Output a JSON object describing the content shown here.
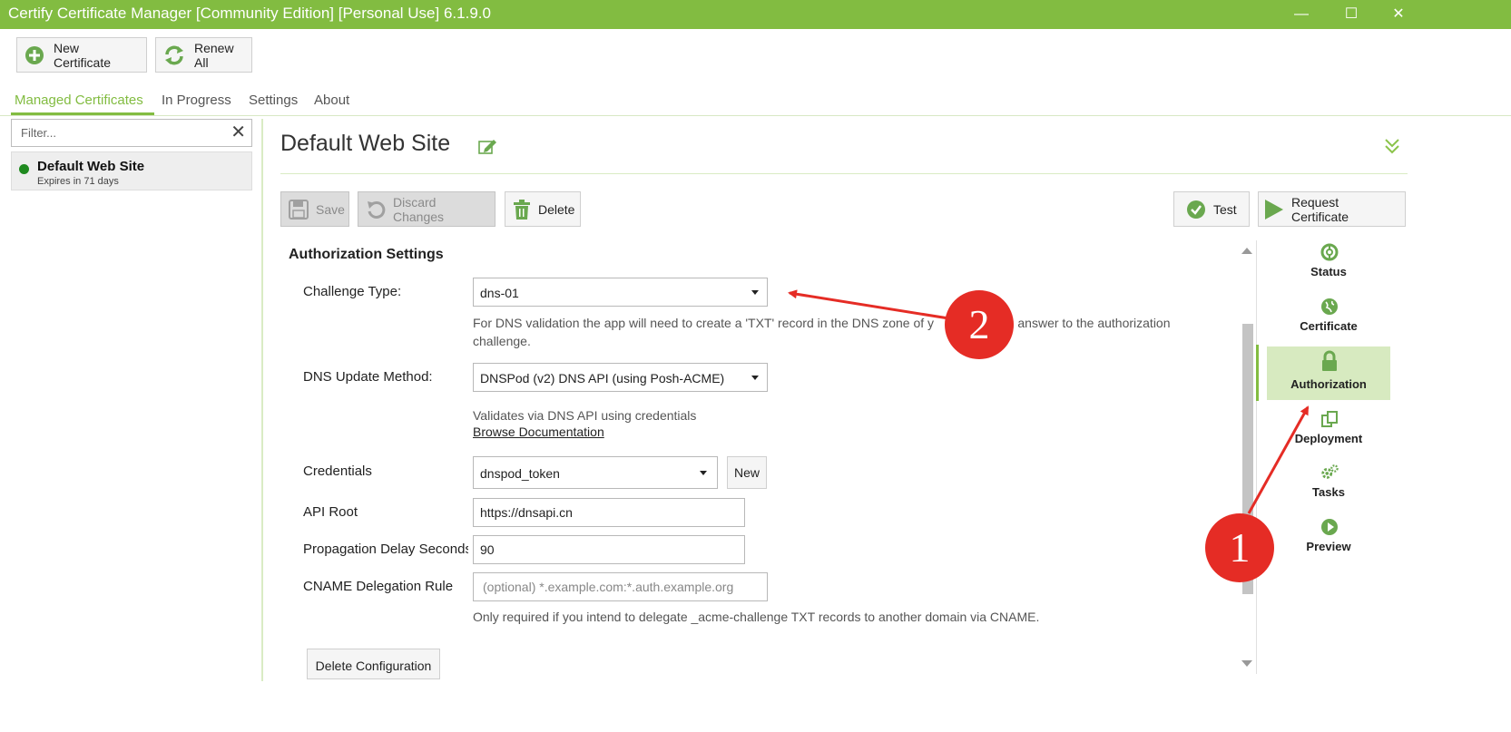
{
  "window": {
    "title": "Certify Certificate Manager [Community Edition] [Personal Use] 6.1.9.0",
    "controls": {
      "minimize": "—",
      "maximize": "☐",
      "close": "✕"
    }
  },
  "toolbar": {
    "new_certificate": "New Certificate",
    "renew_all": "Renew All"
  },
  "tabs": {
    "managed": "Managed Certificates",
    "in_progress": "In Progress",
    "settings": "Settings",
    "about": "About"
  },
  "sidebar": {
    "filter_placeholder": "Filter...",
    "clear": "✕",
    "items": [
      {
        "name": "Default Web Site",
        "expires": "Expires in 71 days",
        "status_color": "#1f8a1f"
      }
    ]
  },
  "main": {
    "title": "Default Web Site",
    "actions": {
      "save": "Save",
      "discard": "Discard Changes",
      "delete": "Delete",
      "test": "Test",
      "request": "Request Certificate"
    },
    "authorization": {
      "section_title": "Authorization Settings",
      "challenge_type_label": "Challenge Type:",
      "challenge_type_value": "dns-01",
      "challenge_help_1": "For DNS validation the app will need to create a 'TXT' record in the DNS zone of y",
      "challenge_help_2": "(s) as an answer to the authorization",
      "challenge_help_3": "challenge.",
      "dns_method_label": "DNS Update Method:",
      "dns_method_value": "DNSPod (v2) DNS API (using Posh-ACME)",
      "dns_help": "Validates via DNS API using credentials",
      "browse_docs": "Browse Documentation",
      "credentials_label": "Credentials",
      "credentials_value": "dnspod_token",
      "credentials_new": "New",
      "api_root_label": "API Root",
      "api_root_value": "https://dnsapi.cn",
      "propagation_label": "Propagation Delay Seconds",
      "propagation_value": "90",
      "cname_label": "CNAME Delegation Rule",
      "cname_placeholder": "(optional) *.example.com:*.auth.example.org",
      "cname_help": "Only required if you intend to delegate _acme-challenge TXT records to another domain via CNAME.",
      "delete_config": "Delete Configuration"
    }
  },
  "sidenav": [
    {
      "label": "Status",
      "icon": "lifebuoy-icon"
    },
    {
      "label": "Certificate",
      "icon": "globe-icon"
    },
    {
      "label": "Authorization",
      "icon": "lock-icon",
      "active": true
    },
    {
      "label": "Deployment",
      "icon": "copy-icon"
    },
    {
      "label": "Tasks",
      "icon": "gears-icon"
    },
    {
      "label": "Preview",
      "icon": "play-icon"
    }
  ],
  "annotations": {
    "badge_1": "1",
    "badge_2": "2",
    "color": "#e52c25"
  },
  "colors": {
    "accent": "#82bc41",
    "annotation": "#e52c25"
  }
}
